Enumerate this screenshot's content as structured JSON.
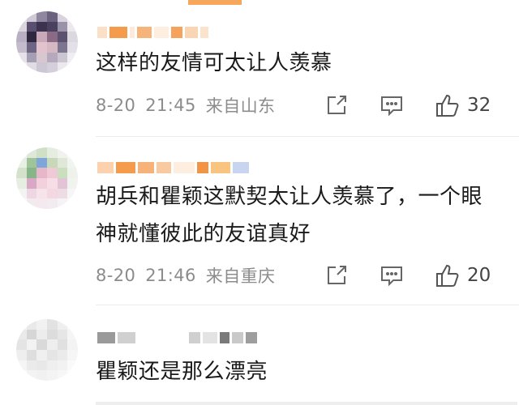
{
  "comments": [
    {
      "text": "这样的友情可太让人羡慕",
      "date": "8-20",
      "time": "21:45",
      "location": "来自山东",
      "likes": "32"
    },
    {
      "text": "胡兵和瞿颖这默契太让人羡慕了，一个眼神就懂彼此的友谊真好",
      "date": "8-20",
      "time": "21:46",
      "location": "来自重庆",
      "likes": "20"
    },
    {
      "text": "瞿颖还是那么漂亮"
    }
  ],
  "icons": {
    "share": "share-icon",
    "comment": "comment-icon",
    "like": "thumbs-up-icon"
  },
  "colors": {
    "meta_text": "#8c8c8c",
    "body_text": "#1a1a1a",
    "accent_orange": "#f7a75b"
  }
}
